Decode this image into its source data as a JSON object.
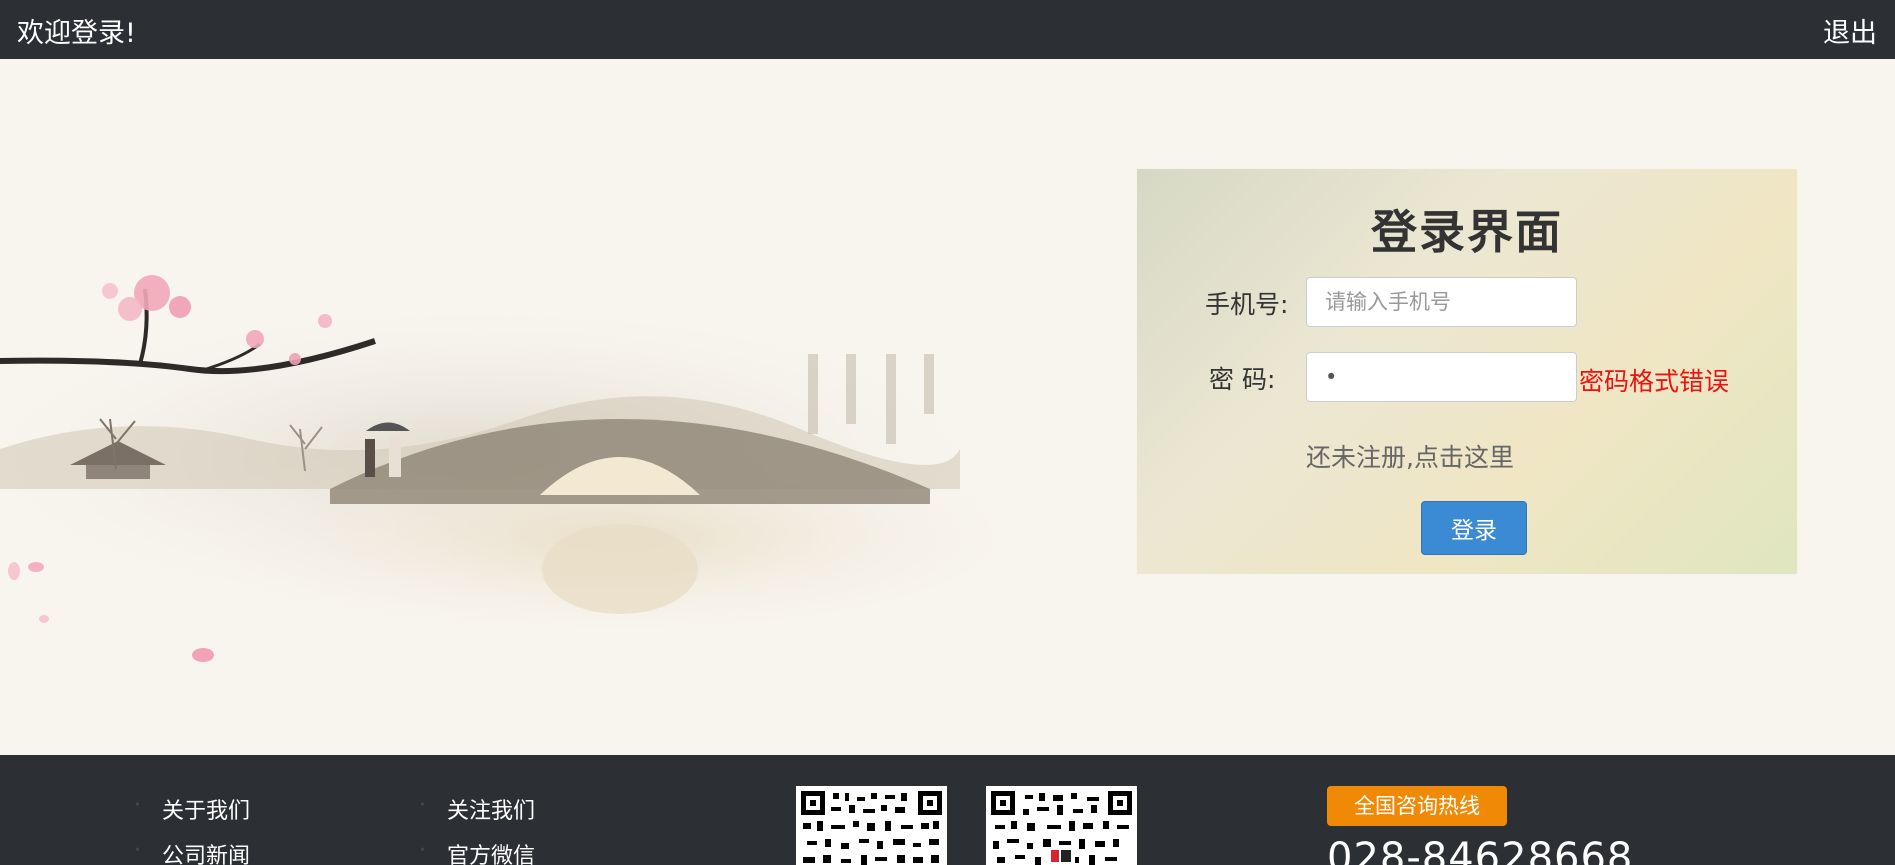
{
  "header": {
    "welcome_text": "欢迎登录!",
    "logout_label": "退出"
  },
  "login": {
    "title": "登录界面",
    "phone_label": "手机号:",
    "phone_placeholder": "请输入手机号",
    "password_label": "密   码:",
    "password_value": "•",
    "password_error": "密码格式错误",
    "register_link": "还未注册,点击这里",
    "submit_label": "登录"
  },
  "footer": {
    "links_col1": [
      "关于我们",
      "公司新闻"
    ],
    "links_col2": [
      "关注我们",
      "官方微信"
    ],
    "hotline_label": "全国咨询热线",
    "hotline_number": "028-84628668"
  },
  "colors": {
    "header_bg": "#2c2f34",
    "accent_button": "#3b8bd4",
    "error_text": "#ee1111",
    "hotline_badge": "#f08a06"
  }
}
